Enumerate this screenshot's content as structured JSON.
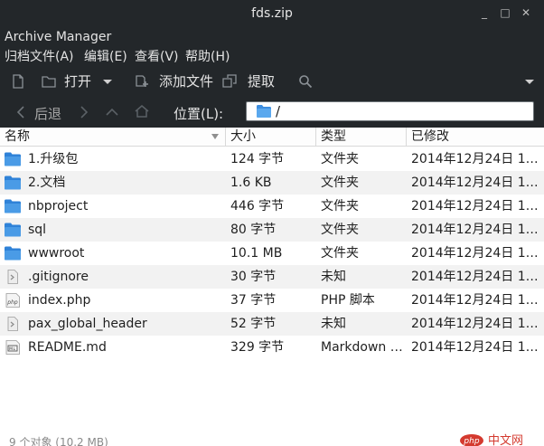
{
  "window": {
    "title": "fds.zip",
    "controls": [
      "_",
      "□",
      "✕"
    ]
  },
  "app": {
    "name": "Archive Manager"
  },
  "menu": {
    "items": [
      "归档文件(A)",
      "编辑(E)",
      "查看(V)",
      "帮助(H)"
    ]
  },
  "toolbar": {
    "open_label": "打开",
    "add_files_label": "添加文件",
    "extract_label": "提取"
  },
  "location": {
    "back_label": "后退",
    "location_label": "位置(L):",
    "path": "/"
  },
  "table": {
    "headers": [
      "名称",
      "大小",
      "类型",
      "已修改"
    ],
    "rows": [
      {
        "name": "1.升级包",
        "size": "124 字节",
        "type": "文件夹",
        "modified": "2014年12月24日 1…",
        "icon": "folder-icon"
      },
      {
        "name": "2.文档",
        "size": "1.6 KB",
        "type": "文件夹",
        "modified": "2014年12月24日 1…",
        "icon": "folder-icon"
      },
      {
        "name": "nbproject",
        "size": "446 字节",
        "type": "文件夹",
        "modified": "2014年12月24日 1…",
        "icon": "folder-icon"
      },
      {
        "name": "sql",
        "size": "80 字节",
        "type": "文件夹",
        "modified": "2014年12月24日 1…",
        "icon": "folder-icon"
      },
      {
        "name": "wwwroot",
        "size": "10.1 MB",
        "type": "文件夹",
        "modified": "2014年12月24日 1…",
        "icon": "folder-icon"
      },
      {
        "name": ".gitignore",
        "size": "30 字节",
        "type": "未知",
        "modified": "2014年12月24日 1…",
        "icon": "unknown-file-icon"
      },
      {
        "name": "index.php",
        "size": "37 字节",
        "type": "PHP 脚本",
        "modified": "2014年12月24日 1…",
        "icon": "php-file-icon"
      },
      {
        "name": "pax_global_header",
        "size": "52 字节",
        "type": "未知",
        "modified": "2014年12月24日 1…",
        "icon": "unknown-file-icon"
      },
      {
        "name": "README.md",
        "size": "329 字节",
        "type": "Markdown …",
        "modified": "2014年12月24日 1…",
        "icon": "markdown-file-icon"
      }
    ]
  },
  "status": {
    "text": "9 个对象 (10.2 MB)"
  },
  "watermark": {
    "text": "php 中文网"
  },
  "colors": {
    "toolbar_bg": "#23272a",
    "folder_blue": "#3d8ee0",
    "row_alt": "#f2f2f2"
  }
}
